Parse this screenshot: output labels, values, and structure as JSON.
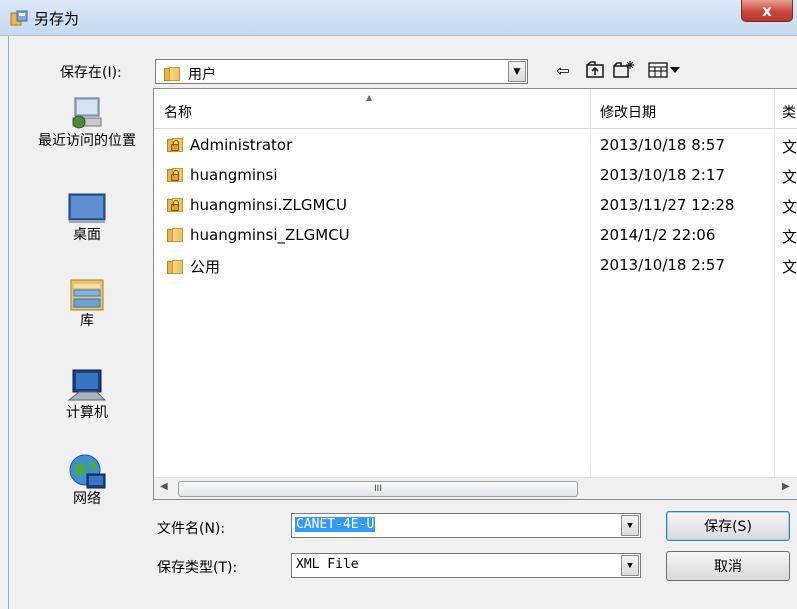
{
  "window": {
    "title": "另存为",
    "close_label": "x"
  },
  "save_in": {
    "label": "保存在(I):",
    "value": "用户"
  },
  "toolbar": {
    "back_icon": "back-arrow-icon",
    "up_icon": "up-folder-icon",
    "new_folder_icon": "new-folder-icon",
    "view_icon": "view-menu-icon",
    "back_glyph": "⇦",
    "up_glyph": "⮤",
    "new_folder_glyph": "✶",
    "view_glyph": "▦▾"
  },
  "places": [
    {
      "label": "最近访问的位置",
      "icon": "recent-places-icon"
    },
    {
      "label": "桌面",
      "icon": "desktop-icon"
    },
    {
      "label": "库",
      "icon": "library-icon"
    },
    {
      "label": "计算机",
      "icon": "computer-icon"
    },
    {
      "label": "网络",
      "icon": "network-icon"
    }
  ],
  "columns": {
    "name": "名称",
    "modified": "修改日期",
    "type": "类"
  },
  "files": [
    {
      "name": "Administrator",
      "date": "2013/10/18 8:57",
      "type": "文",
      "locked": true
    },
    {
      "name": "huangminsi",
      "date": "2013/10/18 2:17",
      "type": "文",
      "locked": true
    },
    {
      "name": "huangminsi.ZLGMCU",
      "date": "2013/11/27 12:28",
      "type": "文",
      "locked": true
    },
    {
      "name": "huangminsi_ZLGMCU",
      "date": "2014/1/2 22:06",
      "type": "文",
      "locked": false
    },
    {
      "name": "公用",
      "date": "2013/10/18 2:57",
      "type": "文",
      "locked": false
    }
  ],
  "scrollbar": {
    "thumb_grip": "III"
  },
  "filename": {
    "label": "文件名(N):",
    "value": "CANET-4E-U"
  },
  "filetype": {
    "label": "保存类型(T):",
    "value": "XML File"
  },
  "buttons": {
    "save": "保存(S)",
    "cancel": "取消"
  },
  "colors": {
    "selection": "#3399ff",
    "close": "#c8483a",
    "folder": "#eec15b"
  }
}
